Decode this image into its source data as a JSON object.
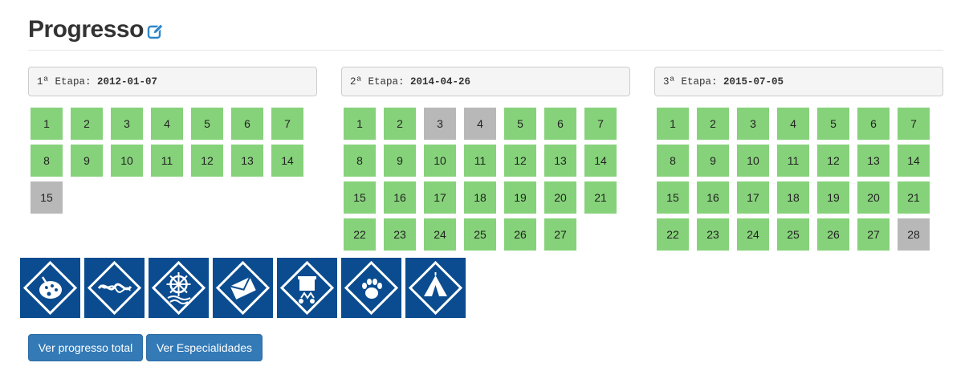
{
  "page": {
    "title": "Progresso"
  },
  "stages": [
    {
      "label": "1ª Etapa:",
      "date": "2012-01-07",
      "items": [
        {
          "n": "1",
          "done": true
        },
        {
          "n": "2",
          "done": true
        },
        {
          "n": "3",
          "done": true
        },
        {
          "n": "4",
          "done": true
        },
        {
          "n": "5",
          "done": true
        },
        {
          "n": "6",
          "done": true
        },
        {
          "n": "7",
          "done": true
        },
        {
          "n": "8",
          "done": true
        },
        {
          "n": "9",
          "done": true
        },
        {
          "n": "10",
          "done": true
        },
        {
          "n": "11",
          "done": true
        },
        {
          "n": "12",
          "done": true
        },
        {
          "n": "13",
          "done": true
        },
        {
          "n": "14",
          "done": true
        },
        {
          "n": "15",
          "done": false
        }
      ]
    },
    {
      "label": "2ª Etapa:",
      "date": "2014-04-26",
      "items": [
        {
          "n": "1",
          "done": true
        },
        {
          "n": "2",
          "done": true
        },
        {
          "n": "3",
          "done": false
        },
        {
          "n": "4",
          "done": false
        },
        {
          "n": "5",
          "done": true
        },
        {
          "n": "6",
          "done": true
        },
        {
          "n": "7",
          "done": true
        },
        {
          "n": "8",
          "done": true
        },
        {
          "n": "9",
          "done": true
        },
        {
          "n": "10",
          "done": true
        },
        {
          "n": "11",
          "done": true
        },
        {
          "n": "12",
          "done": true
        },
        {
          "n": "13",
          "done": true
        },
        {
          "n": "14",
          "done": true
        },
        {
          "n": "15",
          "done": true
        },
        {
          "n": "16",
          "done": true
        },
        {
          "n": "17",
          "done": true
        },
        {
          "n": "18",
          "done": true
        },
        {
          "n": "19",
          "done": true
        },
        {
          "n": "20",
          "done": true
        },
        {
          "n": "21",
          "done": true
        },
        {
          "n": "22",
          "done": true
        },
        {
          "n": "23",
          "done": true
        },
        {
          "n": "24",
          "done": true
        },
        {
          "n": "25",
          "done": true
        },
        {
          "n": "26",
          "done": true
        },
        {
          "n": "27",
          "done": true
        }
      ]
    },
    {
      "label": "3ª Etapa:",
      "date": "2015-07-05",
      "items": [
        {
          "n": "1",
          "done": true
        },
        {
          "n": "2",
          "done": true
        },
        {
          "n": "3",
          "done": true
        },
        {
          "n": "4",
          "done": true
        },
        {
          "n": "5",
          "done": true
        },
        {
          "n": "6",
          "done": true
        },
        {
          "n": "7",
          "done": true
        },
        {
          "n": "8",
          "done": true
        },
        {
          "n": "9",
          "done": true
        },
        {
          "n": "10",
          "done": true
        },
        {
          "n": "11",
          "done": true
        },
        {
          "n": "12",
          "done": true
        },
        {
          "n": "13",
          "done": true
        },
        {
          "n": "14",
          "done": true
        },
        {
          "n": "15",
          "done": true
        },
        {
          "n": "16",
          "done": true
        },
        {
          "n": "17",
          "done": true
        },
        {
          "n": "18",
          "done": true
        },
        {
          "n": "19",
          "done": true
        },
        {
          "n": "20",
          "done": true
        },
        {
          "n": "21",
          "done": true
        },
        {
          "n": "22",
          "done": true
        },
        {
          "n": "23",
          "done": true
        },
        {
          "n": "24",
          "done": true
        },
        {
          "n": "25",
          "done": true
        },
        {
          "n": "26",
          "done": true
        },
        {
          "n": "27",
          "done": true
        },
        {
          "n": "28",
          "done": false
        }
      ]
    }
  ],
  "badges": [
    {
      "icon": "art-palette-icon"
    },
    {
      "icon": "knot-icon"
    },
    {
      "icon": "ship-wheel-icon"
    },
    {
      "icon": "envelope-icon"
    },
    {
      "icon": "cooking-pot-icon"
    },
    {
      "icon": "paw-print-icon"
    },
    {
      "icon": "tent-icon"
    }
  ],
  "buttons": {
    "total_progress": "Ver progresso total",
    "specialties": "Ver Especialidades"
  },
  "colors": {
    "done": "#86d27a",
    "pending": "#b8b8b8",
    "badge_bg": "#0a4c8f",
    "primary": "#337ab7",
    "accent_icon": "#2e86c9"
  }
}
